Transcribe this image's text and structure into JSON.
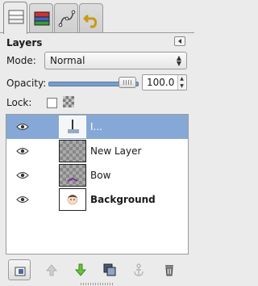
{
  "panel": {
    "title": "Layers"
  },
  "mode": {
    "label": "Mode:",
    "value": "Normal"
  },
  "opacity": {
    "label": "Opacity:",
    "value": "100.0",
    "fraction": 1.0
  },
  "lock": {
    "label": "Lock:",
    "checked": false
  },
  "layers": [
    {
      "name": "I...",
      "visible": true,
      "selected": true,
      "bold": false
    },
    {
      "name": "New Layer",
      "visible": true,
      "selected": false,
      "bold": false
    },
    {
      "name": "Bow",
      "visible": true,
      "selected": false,
      "bold": false
    },
    {
      "name": "Background",
      "visible": true,
      "selected": false,
      "bold": true
    }
  ],
  "tabs": [
    "layers-icon",
    "channels-icon",
    "paths-icon",
    "undo-history-icon"
  ],
  "toolbar": [
    "new-layer-icon",
    "raise-layer-icon",
    "lower-layer-icon",
    "duplicate-layer-icon",
    "anchor-layer-icon",
    "delete-layer-icon"
  ],
  "colors": {
    "selection": "#86a8d6",
    "opacity_track": "#7a9cc8"
  }
}
